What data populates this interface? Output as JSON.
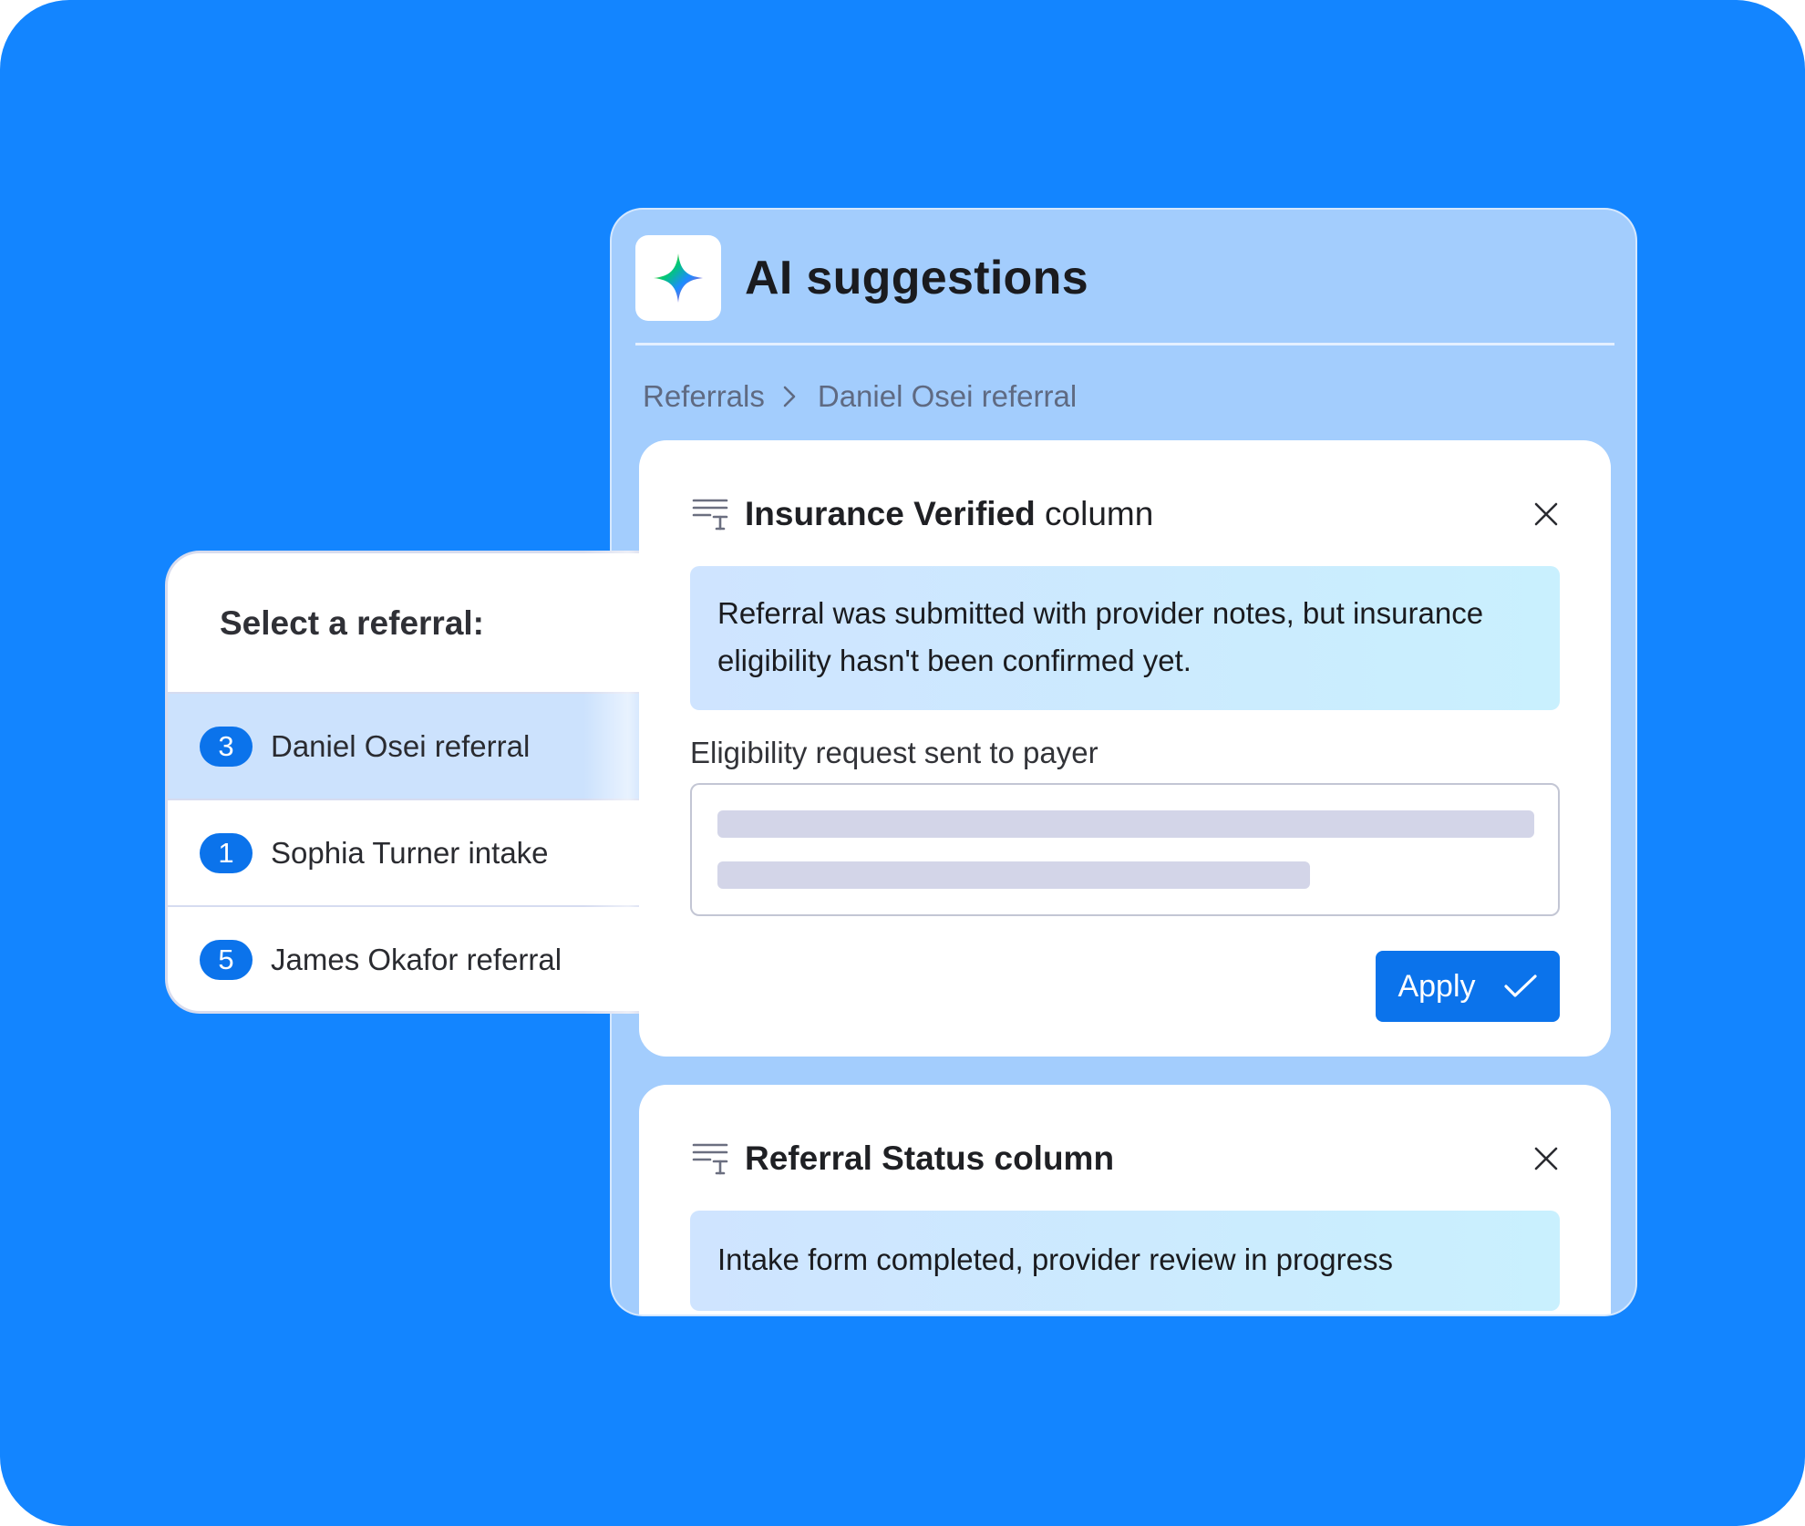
{
  "panel": {
    "title": "AI suggestions",
    "breadcrumb": [
      "Referrals",
      "Daniel Osei referral"
    ]
  },
  "cards": [
    {
      "title_bold": "Insurance Verified",
      "title_rest": " column",
      "note": "Referral was submitted with provider notes, but insurance eligibility hasn't been confirmed yet.",
      "field_label": "Eligibility request sent to payer",
      "apply_label": "Apply"
    },
    {
      "title_bold": "Referral Status column",
      "title_rest": "",
      "note": "Intake form completed, provider review in progress"
    }
  ],
  "selector": {
    "title": "Select a referral:",
    "items": [
      {
        "count": "3",
        "label": "Daniel Osei referral",
        "active": true
      },
      {
        "count": "1",
        "label": "Sophia Turner intake",
        "active": false
      },
      {
        "count": "5",
        "label": "James Okafor referral",
        "active": false
      }
    ]
  },
  "colors": {
    "background": "#1385ff",
    "panel": "#a3cdfd",
    "primary_button": "#0b73eb",
    "selected_row": "#cce2fd"
  },
  "icons": [
    "sparkle-icon",
    "chevron-right-icon",
    "column-text-icon",
    "close-icon",
    "check-icon"
  ]
}
